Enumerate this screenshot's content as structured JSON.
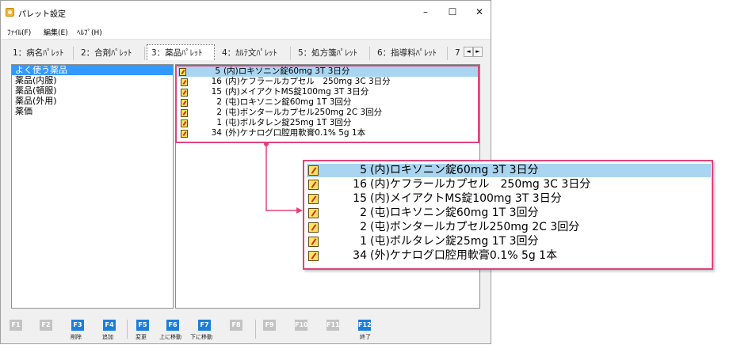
{
  "window": {
    "title": "パレット設定",
    "controls": {
      "minimize": "–",
      "maximize": "☐",
      "close": "✕"
    }
  },
  "menu": [
    "ﾌｧｲﾙ(F)",
    "編集(E)",
    "ﾍﾙﾌﾟ(H)"
  ],
  "tabs": [
    {
      "label": "1：病名ﾊﾟﾚｯﾄ",
      "active": false
    },
    {
      "label": "2：合剤ﾊﾟﾚｯﾄ",
      "active": false
    },
    {
      "label": "3：薬品ﾊﾟﾚｯﾄ",
      "active": true
    },
    {
      "label": "4：ｶﾙﾃ文ﾊﾟﾚｯﾄ",
      "active": false
    },
    {
      "label": "5：処方箋ﾊﾟﾚｯﾄ",
      "active": false
    },
    {
      "label": "6：指導料ﾊﾟﾚｯﾄ",
      "active": false
    },
    {
      "label": "7",
      "active": false
    }
  ],
  "tab_scroll": {
    "left": "◄",
    "right": "►"
  },
  "categories": [
    {
      "label": "よく使う薬品",
      "selected": true
    },
    {
      "label": "薬品(内服)",
      "selected": false
    },
    {
      "label": "薬品(頓服)",
      "selected": false
    },
    {
      "label": "薬品(外用)",
      "selected": false
    },
    {
      "label": "薬価",
      "selected": false
    }
  ],
  "items": [
    {
      "num": "5",
      "text": "(内)ロキソニン錠60mg 3T 3日分",
      "selected": true
    },
    {
      "num": "16",
      "text": "(内)ケフラールカプセル　250mg 3C 3日分",
      "selected": false
    },
    {
      "num": "15",
      "text": "(内)メイアクトMS錠100mg 3T 3日分",
      "selected": false
    },
    {
      "num": "2",
      "text": "(屯)ロキソニン錠60mg 1T 3回分",
      "selected": false
    },
    {
      "num": "2",
      "text": "(屯)ボンタールカプセル250mg 2C 3回分",
      "selected": false
    },
    {
      "num": "1",
      "text": "(屯)ボルタレン錠25mg 1T 3回分",
      "selected": false
    },
    {
      "num": "34",
      "text": "(外)ケナログ口腔用軟膏0.1% 5g 1本",
      "selected": false
    }
  ],
  "fkeys": [
    {
      "key": "F1",
      "label": "",
      "enabled": false
    },
    {
      "key": "F2",
      "label": "",
      "enabled": false
    },
    {
      "key": "F3",
      "label": "削除",
      "enabled": true
    },
    {
      "key": "F4",
      "label": "追加",
      "enabled": true
    },
    {
      "key": "F5",
      "label": "変更",
      "enabled": true
    },
    {
      "key": "F6",
      "label": "上に移動",
      "enabled": true
    },
    {
      "key": "F7",
      "label": "下に移動",
      "enabled": true
    },
    {
      "key": "F8",
      "label": "",
      "enabled": false
    },
    {
      "key": "F9",
      "label": "",
      "enabled": false
    },
    {
      "key": "F10",
      "label": "",
      "enabled": false
    },
    {
      "key": "F11",
      "label": "",
      "enabled": false
    },
    {
      "key": "F12",
      "label": "終了",
      "enabled": true
    }
  ],
  "colors": {
    "highlight": "#e0437c",
    "selection": "#3399ff",
    "row_selection": "#a9d5f0",
    "fkey_enabled": "#1c7fd9",
    "fkey_disabled": "#c3c3c3"
  }
}
